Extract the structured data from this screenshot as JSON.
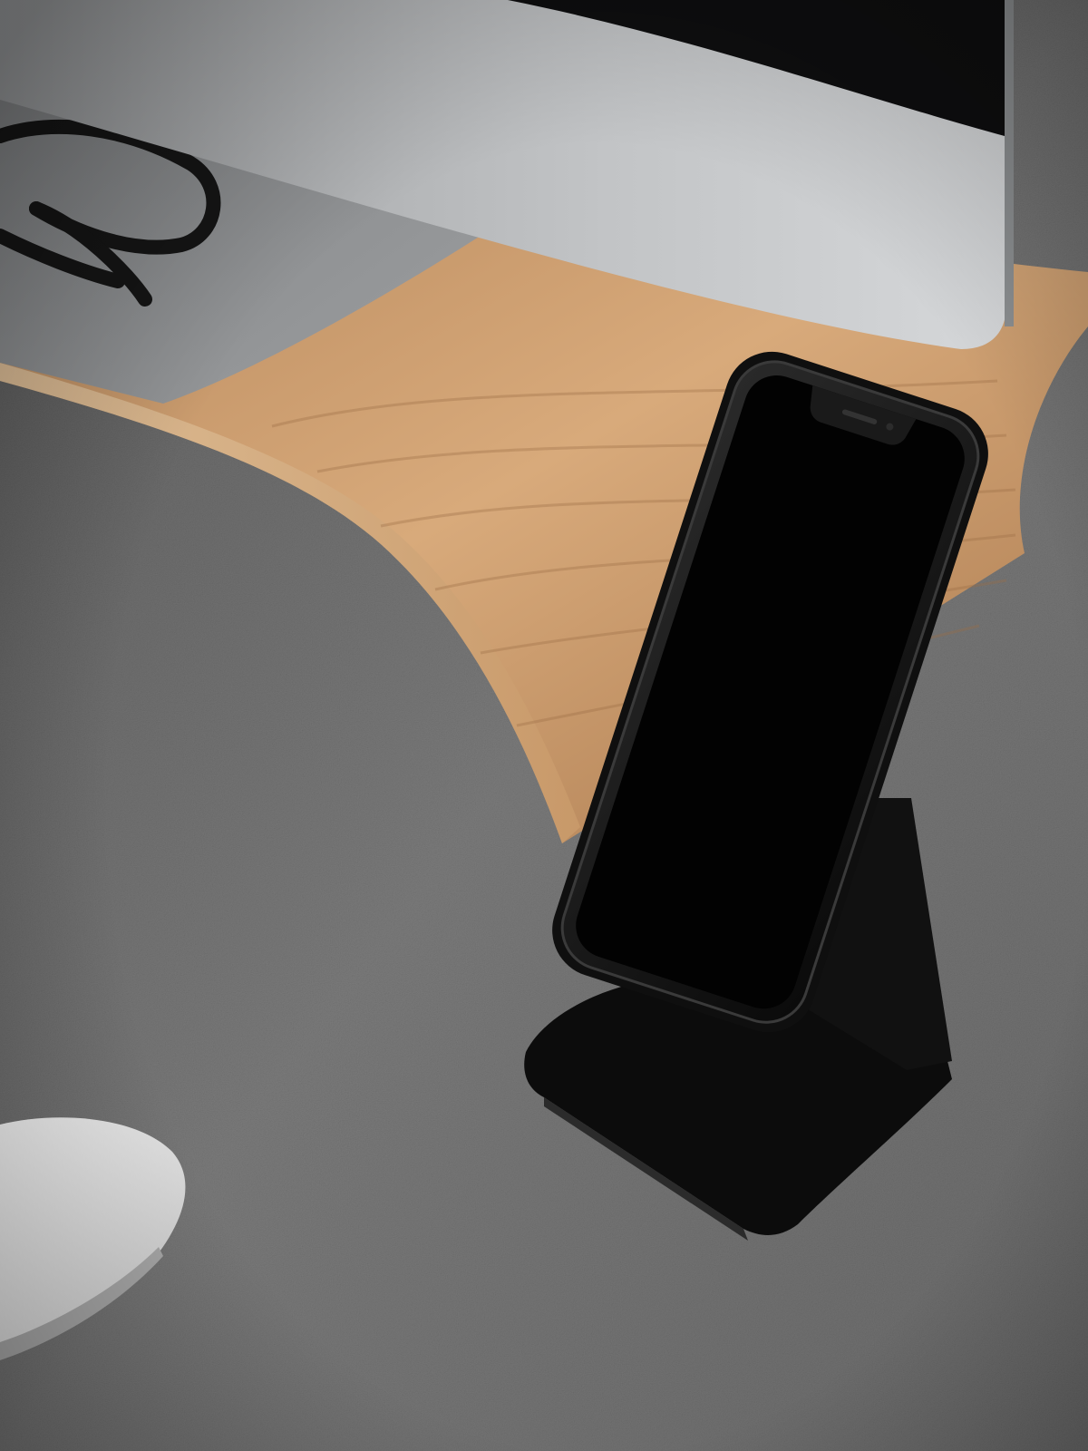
{
  "scene": {
    "kind": "photograph",
    "objects": [
      {
        "name": "desk-felt-pad",
        "color": "#6f6f6f"
      },
      {
        "name": "wooden-monitor-stand",
        "color": "#c8976a"
      },
      {
        "name": "computer-monitor",
        "color": "#b9bcbe"
      },
      {
        "name": "eyeglasses",
        "color": "#1a1a1a"
      },
      {
        "name": "smartphone-in-stand",
        "color": "#050505"
      },
      {
        "name": "phone-stand",
        "color": "#0b0b0b"
      },
      {
        "name": "computer-mouse",
        "color": "#e6e6e6"
      }
    ]
  }
}
